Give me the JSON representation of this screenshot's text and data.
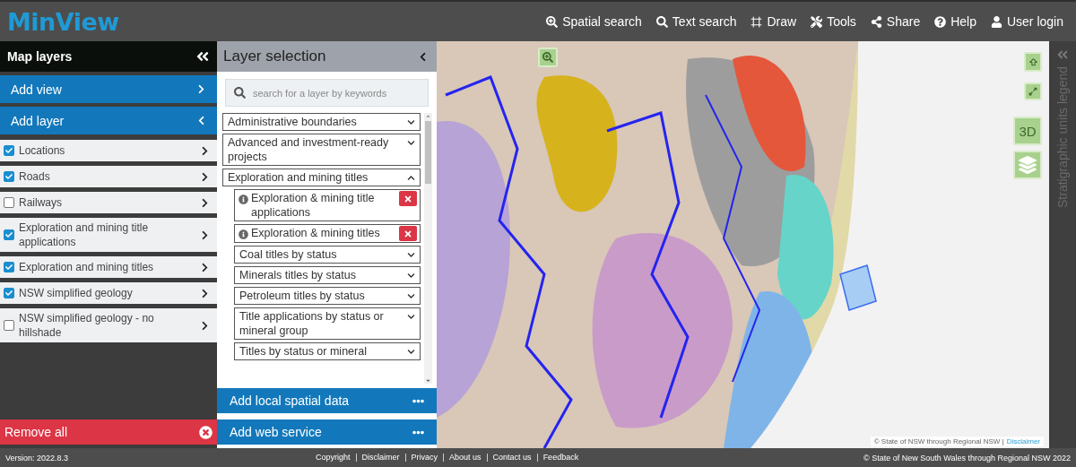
{
  "header": {
    "logo": "MinView",
    "nav": [
      {
        "label": "Spatial search"
      },
      {
        "label": "Text search"
      },
      {
        "label": "Draw"
      },
      {
        "label": "Tools"
      },
      {
        "label": "Share"
      },
      {
        "label": "Help"
      },
      {
        "label": "User login"
      }
    ]
  },
  "map_layers": {
    "title": "Map layers",
    "actions": [
      {
        "label": "Add view",
        "expanded": false
      },
      {
        "label": "Add layer",
        "expanded": true
      }
    ],
    "items": [
      {
        "label": "Locations",
        "checked": true
      },
      {
        "label": "Roads",
        "checked": true
      },
      {
        "label": "Railways",
        "checked": false
      },
      {
        "label": "Exploration and mining title applications",
        "checked": true
      },
      {
        "label": "Exploration and mining titles",
        "checked": true
      },
      {
        "label": "NSW simplified geology",
        "checked": true
      },
      {
        "label": "NSW simplified geology - no hillshade",
        "checked": false
      }
    ],
    "remove_all": "Remove all"
  },
  "layer_selection": {
    "title": "Layer selection",
    "search": {
      "placeholder": "search for a layer by keywords"
    },
    "groups": [
      {
        "kind": "group",
        "label": "Administrative boundaries",
        "expanded": false
      },
      {
        "kind": "group",
        "label": "Advanced and investment-ready projects",
        "expanded": false
      },
      {
        "kind": "group",
        "label": "Exploration and mining titles",
        "expanded": true,
        "children": [
          {
            "kind": "layer",
            "label": "Exploration & mining title applications"
          },
          {
            "kind": "layer",
            "label": "Exploration & mining titles"
          },
          {
            "kind": "group",
            "label": "Coal titles by status",
            "expanded": false
          },
          {
            "kind": "group",
            "label": "Minerals titles by status",
            "expanded": false
          },
          {
            "kind": "group",
            "label": "Petroleum titles by status",
            "expanded": false
          },
          {
            "kind": "group",
            "label": "Title applications by status or mineral group",
            "expanded": false
          },
          {
            "kind": "group",
            "label": "Titles by status or mineral",
            "expanded": false
          }
        ]
      }
    ],
    "buttons": [
      "Add local spatial data",
      "Add web service"
    ]
  },
  "map": {
    "kind": "picture",
    "controls": {
      "three_d": "3D"
    },
    "attribution": {
      "text": "© State of NSW through Regional NSW |",
      "link": "Disclaimer"
    }
  },
  "legend": {
    "title": "Stratigraphic units legend"
  },
  "footer": {
    "version": "Version: 2022.8.3",
    "links": [
      "Copyright",
      "Disclaimer",
      "Privacy",
      "About us",
      "Contact us",
      "Feedback"
    ],
    "copyright": "© State of New South Wales through Regional NSW 2022"
  }
}
